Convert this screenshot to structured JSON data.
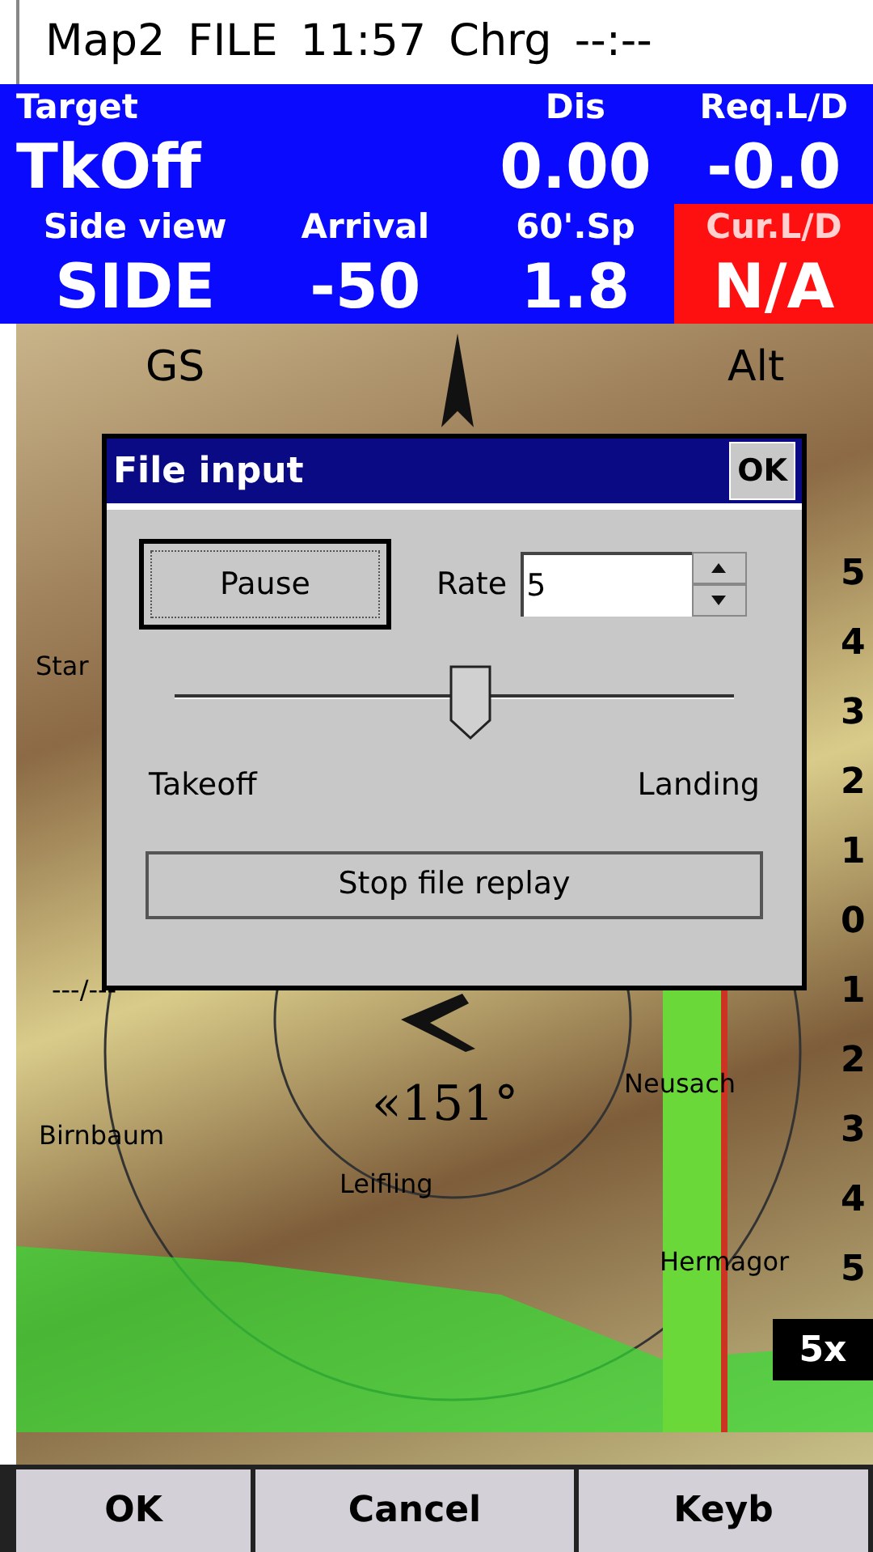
{
  "status_bar": [
    "Map2",
    "FILE",
    "11:57",
    "Chrg",
    "--:--"
  ],
  "infobox_row_1": [
    {
      "label": "Target",
      "value": "TkOff",
      "alert": false
    },
    {
      "label": "Dis",
      "value": "0.00",
      "alert": false
    },
    {
      "label": "Req.L/D",
      "value": "-0.0",
      "alert": false
    }
  ],
  "infobox_row_2": [
    {
      "label": "Side view",
      "value": "SIDE",
      "alert": false
    },
    {
      "label": "Arrival",
      "value": "-50",
      "alert": false
    },
    {
      "label": "60'.Sp",
      "value": "1.8",
      "alert": false
    },
    {
      "label": "Cur.L/D",
      "value": "N/A",
      "alert": true
    }
  ],
  "map": {
    "labels": [
      "GS",
      "Alt",
      "Star",
      "---/---",
      "Birnbaum",
      "Leifling",
      "Neusach",
      "Hermagor"
    ],
    "bearing": "«151°",
    "scale_ticks": [
      "5",
      "4",
      "3",
      "2",
      "1",
      "0",
      "1",
      "2",
      "3",
      "4",
      "5"
    ],
    "zoom": "5x"
  },
  "dialog": {
    "title": "File input",
    "ok": "OK",
    "pause": "Pause",
    "rate_label": "Rate",
    "rate_value": "5",
    "slider": {
      "level": 0.53,
      "start": "Takeoff",
      "end": "Landing"
    },
    "stop": "Stop file replay"
  },
  "buttons": [
    "OK",
    "Cancel",
    "Keyb"
  ]
}
